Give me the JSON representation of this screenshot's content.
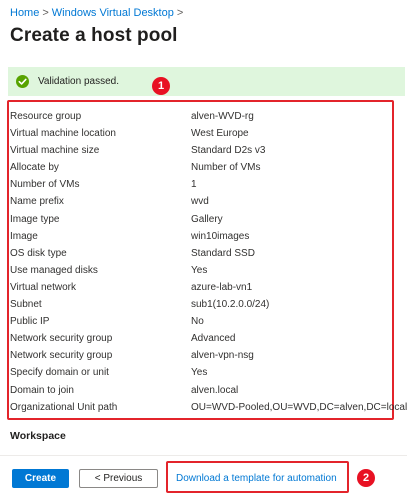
{
  "breadcrumb": {
    "home": "Home",
    "wvd": "Windows Virtual Desktop",
    "separator": ">"
  },
  "page_title": "Create a host pool",
  "validation": {
    "message": "Validation passed.",
    "status_color": "#57a300"
  },
  "callouts": [
    "1",
    "2"
  ],
  "summary": {
    "rows": [
      {
        "label": "Resource group",
        "value": "alven-WVD-rg"
      },
      {
        "label": "Virtual machine location",
        "value": "West Europe"
      },
      {
        "label": "Virtual machine size",
        "value": "Standard D2s v3"
      },
      {
        "label": "Allocate by",
        "value": "Number of VMs"
      },
      {
        "label": "Number of VMs",
        "value": "1"
      },
      {
        "label": "Name prefix",
        "value": "wvd"
      },
      {
        "label": "Image type",
        "value": "Gallery"
      },
      {
        "label": "Image",
        "value": "win10images"
      },
      {
        "label": "OS disk type",
        "value": "Standard SSD"
      },
      {
        "label": "Use managed disks",
        "value": "Yes"
      },
      {
        "label": "Virtual network",
        "value": "azure-lab-vn1"
      },
      {
        "label": "Subnet",
        "value": "sub1(10.2.0.0/24)"
      },
      {
        "label": "Public IP",
        "value": "No"
      },
      {
        "label": "Network security group",
        "value": "Advanced"
      },
      {
        "label": "Network security group",
        "value": "alven-vpn-nsg"
      },
      {
        "label": "Specify domain or unit",
        "value": "Yes"
      },
      {
        "label": "Domain to join",
        "value": "alven.local"
      },
      {
        "label": "Organizational Unit path",
        "value": "OU=WVD-Pooled,OU=WVD,DC=alven,DC=local"
      }
    ]
  },
  "workspace_heading": "Workspace",
  "footer": {
    "create_label": "Create",
    "previous_label": "< Previous",
    "download_label": "Download a template for automation"
  },
  "colors": {
    "accent": "#0078d4",
    "highlight": "#e3242b",
    "validation_bg": "#dff6dd"
  }
}
